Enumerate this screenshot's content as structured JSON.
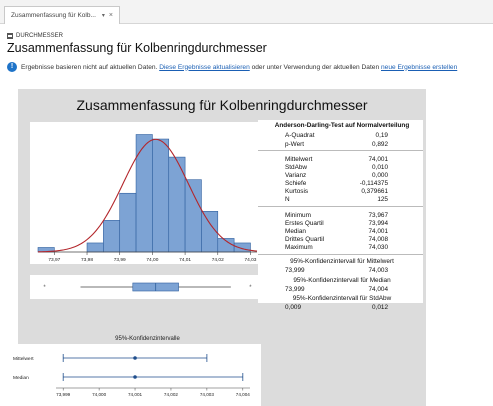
{
  "tab": {
    "label": "Zusammenfassung für Kolb...",
    "dropdown_icon": "chevron-down-icon",
    "close_icon": "close-icon"
  },
  "section_label": "DURCHMESSER",
  "page_title": "Zusammenfassung für Kolbenringdurchmesser",
  "info": {
    "text_before": "Ergebnisse basieren nicht auf aktuellen Daten.",
    "link1": "Diese Ergebnisse aktualisieren",
    "text_middle": "oder unter Verwendung der aktuellen Daten",
    "link2": "neue Ergebnisse erstellen"
  },
  "report": {
    "title": "Zusammenfassung für Kolbenringdurchmesser",
    "ad_header": "Anderson-Darling-Test auf Normalverteilung",
    "ad_rows": [
      {
        "label": "A-Quadrat",
        "value": "0,19"
      },
      {
        "label": "p-Wert",
        "value": "0,892"
      }
    ],
    "desc_rows": [
      {
        "label": "Mittelwert",
        "value": "74,001"
      },
      {
        "label": "StdAbw",
        "value": "0,010"
      },
      {
        "label": "Varianz",
        "value": "0,000"
      },
      {
        "label": "Schiefe",
        "value": "-0,114375"
      },
      {
        "label": "Kurtosis",
        "value": "0,379661"
      },
      {
        "label": "N",
        "value": "125"
      }
    ],
    "quant_rows": [
      {
        "label": "Minimum",
        "value": "73,967"
      },
      {
        "label": "Erstes Quartil",
        "value": "73,994"
      },
      {
        "label": "Median",
        "value": "74,001"
      },
      {
        "label": "Drittes Quartil",
        "value": "74,008"
      },
      {
        "label": "Maximum",
        "value": "74,030"
      }
    ],
    "ci_mean_header": "95%-Konfidenzintervall für Mittelwert",
    "ci_mean": [
      "73,999",
      "74,003"
    ],
    "ci_median_header": "95%-Konfidenzintervall für Median",
    "ci_median": [
      "73,999",
      "74,004"
    ],
    "ci_sd_header": "95%-Konfidenzintervall für StdAbw",
    "ci_sd": [
      "0,009",
      "0,012"
    ],
    "ci_plot_title": "95%-Konfidenzintervalle",
    "colors": {
      "bar": "#7da3d4",
      "bar_edge": "#2f5f9e",
      "curve": "#b3262b",
      "ci": "#1f4e8c"
    }
  },
  "chart_data": [
    {
      "type": "bar",
      "x_ticks": [
        "73,97",
        "73,98",
        "73,99",
        "74,00",
        "74,01",
        "74,02",
        "74,03"
      ],
      "bins": [
        {
          "x": 73.9675,
          "count": 1
        },
        {
          "x": 73.9725,
          "count": 0
        },
        {
          "x": 73.9775,
          "count": 0
        },
        {
          "x": 73.9825,
          "count": 2
        },
        {
          "x": 73.9875,
          "count": 7
        },
        {
          "x": 73.9925,
          "count": 13
        },
        {
          "x": 73.9975,
          "count": 26
        },
        {
          "x": 74.0025,
          "count": 25
        },
        {
          "x": 74.0075,
          "count": 21
        },
        {
          "x": 74.0125,
          "count": 16
        },
        {
          "x": 74.0175,
          "count": 9
        },
        {
          "x": 74.0225,
          "count": 3
        },
        {
          "x": 74.0275,
          "count": 2
        }
      ],
      "xlim": [
        73.965,
        74.032
      ],
      "normal_fit": {
        "mean": 74.001,
        "sd": 0.01
      },
      "boxplot": {
        "min": 73.978,
        "q1": 73.994,
        "median": 74.001,
        "q3": 74.008,
        "max": 74.024,
        "outliers": [
          73.967,
          74.03
        ]
      }
    },
    {
      "type": "scatter",
      "title": "95%-Konfidenzintervalle",
      "categories": [
        "Mittelwert",
        "Median"
      ],
      "intervals": [
        {
          "name": "Mittelwert",
          "low": 73.999,
          "estimate": 74.001,
          "high": 74.003
        },
        {
          "name": "Median",
          "low": 73.999,
          "estimate": 74.001,
          "high": 74.004
        }
      ],
      "x_ticks": [
        "73,999",
        "74,000",
        "74,001",
        "74,002",
        "74,003",
        "74,004"
      ],
      "xlim": [
        73.9988,
        74.0042
      ]
    }
  ]
}
